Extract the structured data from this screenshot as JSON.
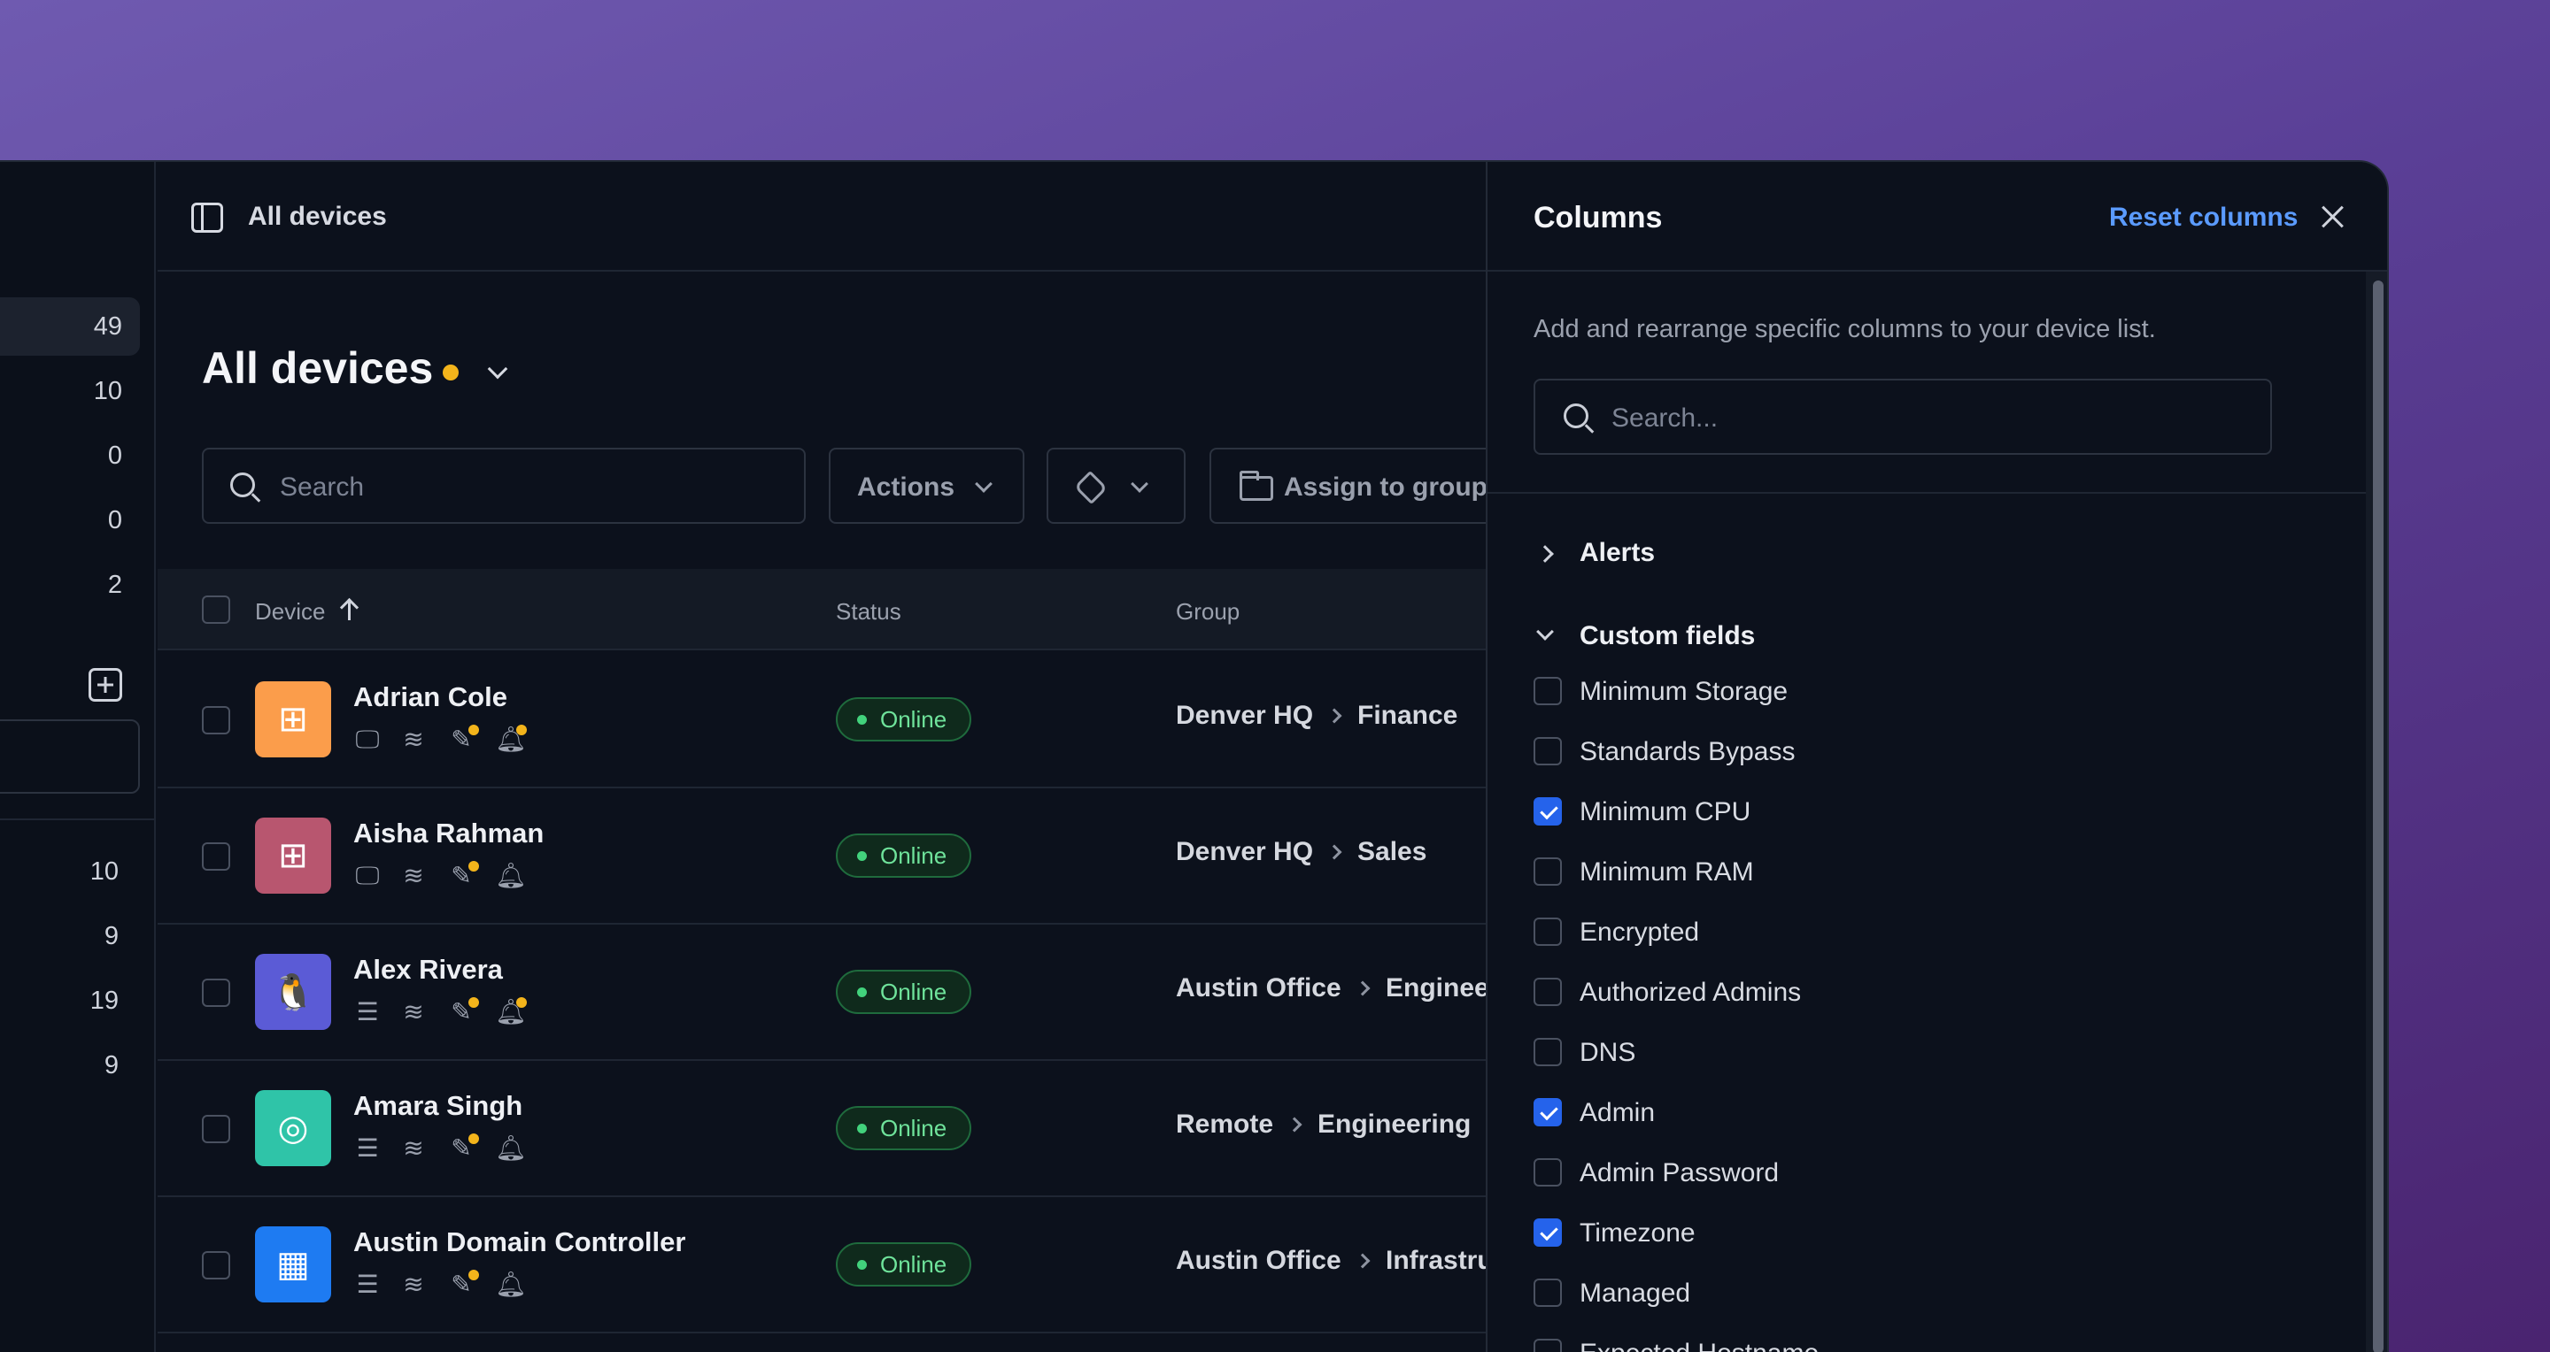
{
  "sidebar": {
    "counts": [
      "49",
      "10",
      "0",
      "0",
      "2"
    ],
    "counts_lower": [
      "10",
      "9",
      "19",
      "9"
    ]
  },
  "topbar": {
    "title": "All devices"
  },
  "page": {
    "title": "All devices"
  },
  "toolbar": {
    "search_placeholder": "Search",
    "actions_label": "Actions",
    "assign_label": "Assign to group"
  },
  "table": {
    "headers": {
      "device": "Device",
      "status": "Status",
      "group": "Group"
    },
    "rows": [
      {
        "name": "Adrian Cole",
        "os": "windows-icon",
        "avatar_color": "#fb9d4b",
        "status": "Online",
        "group": "Denver HQ",
        "subgroup": "Finance",
        "first_icon": "monitor-icon",
        "alert_dot": true
      },
      {
        "name": "Aisha Rahman",
        "os": "windows-icon",
        "avatar_color": "#b8566f",
        "status": "Online",
        "group": "Denver HQ",
        "subgroup": "Sales",
        "first_icon": "monitor-icon",
        "alert_dot": false
      },
      {
        "name": "Alex Rivera",
        "os": "linux-icon",
        "avatar_color": "#5b5bd6",
        "status": "Online",
        "group": "Austin Office",
        "subgroup": "Engineer",
        "first_icon": "server-icon",
        "alert_dot": true
      },
      {
        "name": "Amara Singh",
        "os": "ubuntu-icon",
        "avatar_color": "#2fc4a8",
        "status": "Online",
        "group": "Remote",
        "subgroup": "Engineering",
        "first_icon": "server-icon",
        "alert_dot": false
      },
      {
        "name": "Austin Domain Controller",
        "os": "windows-server-icon",
        "avatar_color": "#1e7bf2",
        "status": "Online",
        "group": "Austin Office",
        "subgroup": "Infrastruc",
        "first_icon": "server-icon",
        "alert_dot": false
      }
    ]
  },
  "columns_panel": {
    "title": "Columns",
    "reset_label": "Reset columns",
    "description": "Add and rearrange specific columns to your device list.",
    "search_placeholder": "Search...",
    "sections": {
      "alerts": "Alerts",
      "custom_fields": "Custom fields"
    },
    "fields": [
      {
        "label": "Minimum Storage",
        "checked": false
      },
      {
        "label": "Standards Bypass",
        "checked": false
      },
      {
        "label": "Minimum CPU",
        "checked": true
      },
      {
        "label": "Minimum RAM",
        "checked": false
      },
      {
        "label": "Encrypted",
        "checked": false
      },
      {
        "label": "Authorized Admins",
        "checked": false
      },
      {
        "label": "DNS",
        "checked": false
      },
      {
        "label": "Admin",
        "checked": true
      },
      {
        "label": "Admin Password",
        "checked": false
      },
      {
        "label": "Timezone",
        "checked": true
      },
      {
        "label": "Managed",
        "checked": false
      },
      {
        "label": "Expected Hostname",
        "checked": false
      }
    ]
  },
  "colors": {
    "accent": "#2563eb",
    "link": "#5b9bff",
    "online_text": "#6fe39b",
    "warning_dot": "#f3b41b"
  }
}
